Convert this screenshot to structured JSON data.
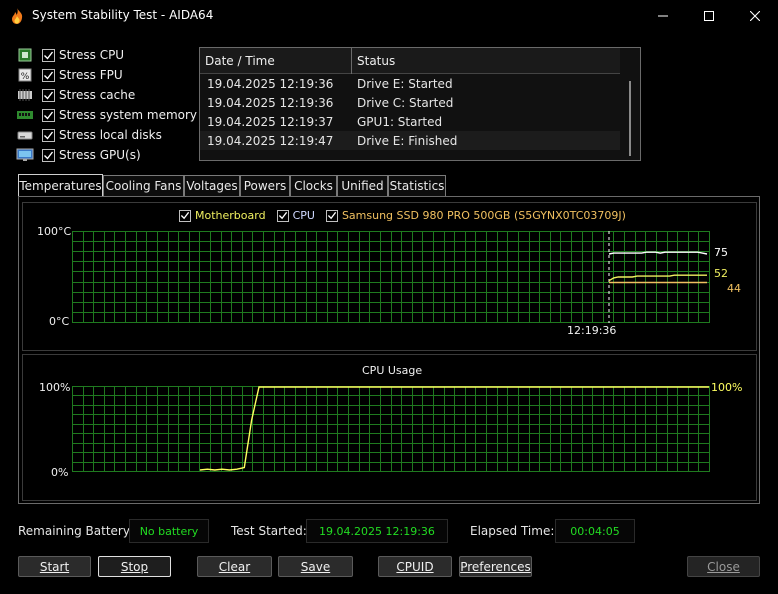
{
  "window": {
    "title": "System Stability Test - AIDA64"
  },
  "stress_options": [
    {
      "label": "Stress CPU",
      "checked": true,
      "icon": "cpu-chip-icon"
    },
    {
      "label": "Stress FPU",
      "checked": true,
      "icon": "fpu-chip-icon"
    },
    {
      "label": "Stress cache",
      "checked": true,
      "icon": "cache-chip-icon"
    },
    {
      "label": "Stress system memory",
      "checked": true,
      "icon": "memory-module-icon"
    },
    {
      "label": "Stress local disks",
      "checked": true,
      "icon": "disk-drive-icon"
    },
    {
      "label": "Stress GPU(s)",
      "checked": true,
      "icon": "gpu-monitor-icon"
    }
  ],
  "log": {
    "headers": [
      "Date / Time",
      "Status"
    ],
    "rows": [
      {
        "datetime": "19.04.2025 12:19:36",
        "status": "Drive E: Started"
      },
      {
        "datetime": "19.04.2025 12:19:36",
        "status": "Drive C: Started"
      },
      {
        "datetime": "19.04.2025 12:19:37",
        "status": "GPU1: Started"
      },
      {
        "datetime": "19.04.2025 12:19:47",
        "status": "Drive E: Finished"
      }
    ]
  },
  "tabs": [
    "Temperatures",
    "Cooling Fans",
    "Voltages",
    "Powers",
    "Clocks",
    "Unified",
    "Statistics"
  ],
  "active_tab": "Temperatures",
  "chart_data": [
    {
      "type": "line",
      "ylim": [
        0,
        100
      ],
      "y_ticks": [
        "100°C",
        "0°C"
      ],
      "x_annotation": "12:19:36",
      "legend": [
        {
          "name": "Motherboard",
          "checked": true,
          "color": "#f0f060"
        },
        {
          "name": "CPU",
          "checked": true,
          "color": "#ffffff"
        },
        {
          "name": "Samsung SSD 980 PRO 500GB (S5GYNX0TC03709J)",
          "checked": true,
          "color": "#f0c060"
        }
      ],
      "series": [
        {
          "name": "CPU",
          "color": "#ffffff",
          "values": [
            75,
            76,
            76,
            76,
            76,
            76,
            76,
            76,
            77,
            77,
            77,
            76,
            77,
            77,
            77,
            77,
            77,
            77,
            77,
            77,
            76,
            75
          ],
          "end_label": "75"
        },
        {
          "name": "Motherboard",
          "color": "#f0f060",
          "values": [
            46,
            49,
            50,
            50,
            50,
            50,
            51,
            51,
            51,
            51,
            51,
            51,
            51,
            51,
            52,
            52,
            52,
            52,
            52,
            52,
            52,
            52
          ],
          "end_label": "52"
        },
        {
          "name": "Samsung SSD 980 PRO 500GB (S5GYNX0TC03709J)",
          "color": "#f0c060",
          "values": [
            44,
            44,
            44,
            44,
            44,
            44,
            44,
            44,
            44,
            44,
            44,
            44,
            44,
            44,
            44,
            44,
            44,
            44,
            44,
            44,
            44,
            44
          ],
          "end_label": "44"
        }
      ]
    },
    {
      "type": "line",
      "title": "CPU Usage",
      "ylim": [
        0,
        100
      ],
      "y_ticks": [
        "100%",
        "0%"
      ],
      "series": [
        {
          "name": "CPU Usage",
          "color": "#ffff60",
          "values": [
            0,
            1,
            0,
            1,
            0,
            1,
            3,
            60,
            100,
            100,
            100,
            100,
            100,
            100,
            100,
            100,
            100,
            100,
            100,
            100,
            100,
            100,
            100,
            100,
            100,
            100,
            100,
            100,
            100,
            100,
            100,
            100,
            100,
            100,
            100,
            100,
            100,
            100,
            100,
            100,
            100,
            100,
            100,
            100,
            100,
            100,
            100,
            100,
            100,
            100,
            100,
            100,
            100,
            100,
            100,
            100,
            100,
            100,
            100,
            100,
            100,
            100,
            100,
            100,
            100,
            100,
            100,
            100,
            100,
            100
          ],
          "end_label": "100%"
        }
      ]
    }
  ],
  "status": {
    "battery_label": "Remaining Battery:",
    "battery_value": "No battery",
    "started_label": "Test Started:",
    "started_value": "19.04.2025 12:19:36",
    "elapsed_label": "Elapsed Time:",
    "elapsed_value": "00:04:05"
  },
  "buttons": {
    "start": "Start",
    "stop": "Stop",
    "clear": "Clear",
    "save": "Save",
    "cpuid": "CPUID",
    "preferences": "Preferences",
    "close": "Close"
  }
}
